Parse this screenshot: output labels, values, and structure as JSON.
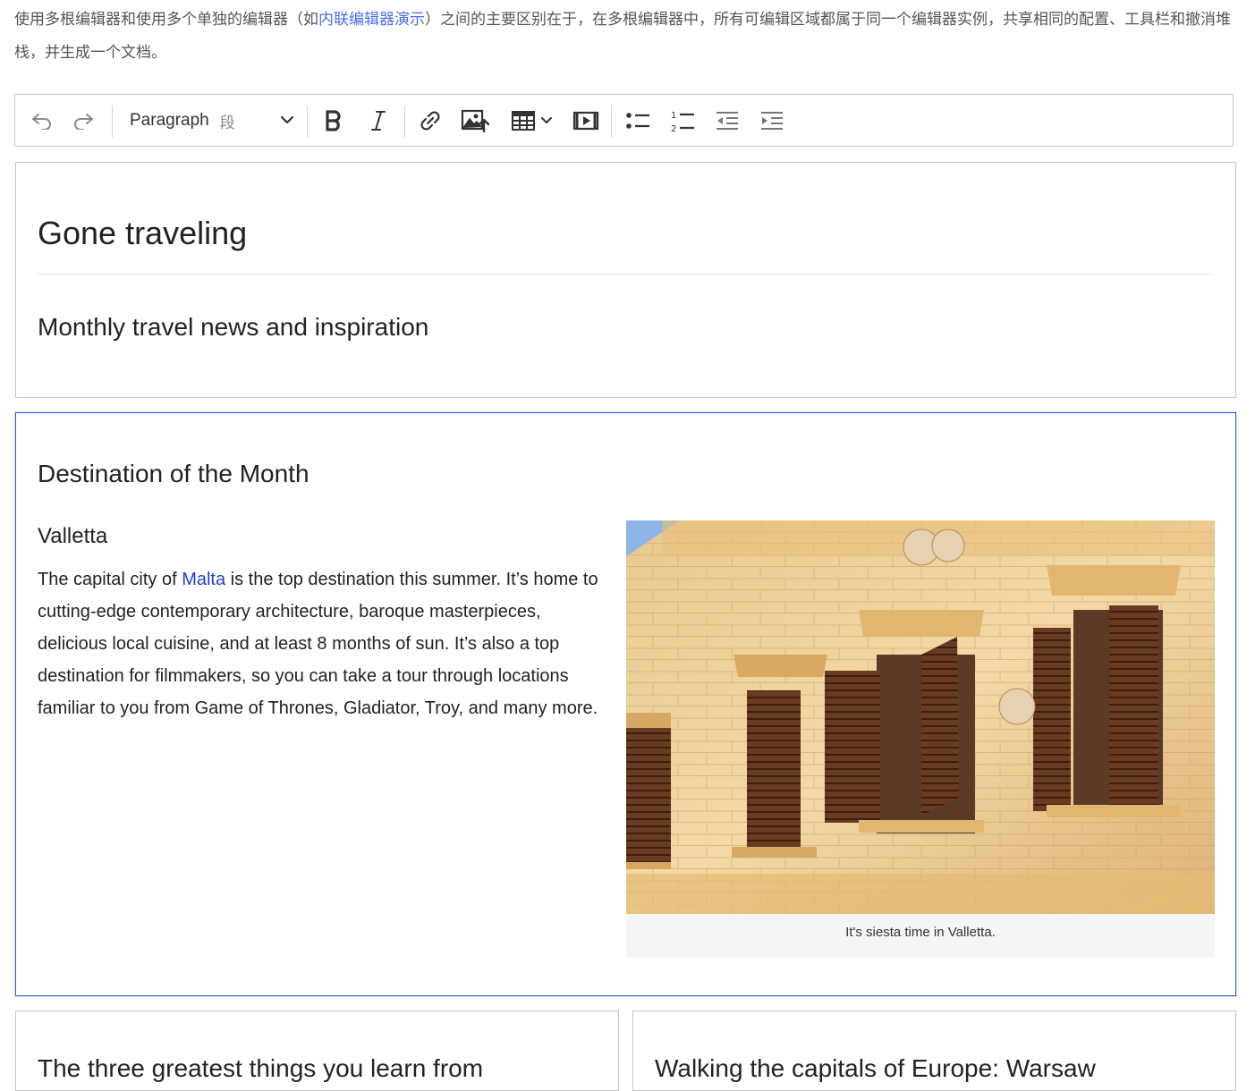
{
  "intro": {
    "text_before": "使用多根编辑器和使用多个单独的编辑器（如",
    "link": "内联编辑器演示",
    "text_after": "）之间的主要区别在于，在多根编辑器中，所有可编辑区域都属于同一个编辑器实例，共享相同的配置、工具栏和撤消堆栈，并生成一个文档。"
  },
  "toolbar": {
    "heading_value": "Paragraph",
    "heading_hint": "段",
    "icons": [
      "undo-icon",
      "redo-icon",
      "bold-icon",
      "italic-icon",
      "link-icon",
      "insert-image-icon",
      "insert-table-icon",
      "insert-media-icon",
      "bulleted-list-icon",
      "numbered-list-icon",
      "outdent-icon",
      "indent-icon"
    ]
  },
  "header": {
    "title": "Gone traveling",
    "subtitle": "Monthly travel news and inspiration"
  },
  "content": {
    "heading": "Destination of the Month",
    "subheading": "Valletta",
    "para_before": "The capital city of ",
    "para_link": "Malta",
    "para_after": " is the top destination this summer. It’s home to cutting-edge contemporary architecture, baroque masterpieces, delicious local cuisine, and at least 8 months of sun. It’s also a top destination for filmmakers, so you can take a tour through locations familiar to you from Game of Thrones, Gladiator, Troy, and many more.",
    "image_caption": "It's siesta time in Valletta."
  },
  "cards": {
    "left_heading": "The three greatest things you learn from",
    "right_heading": "Walking the capitals of Europe: Warsaw"
  }
}
